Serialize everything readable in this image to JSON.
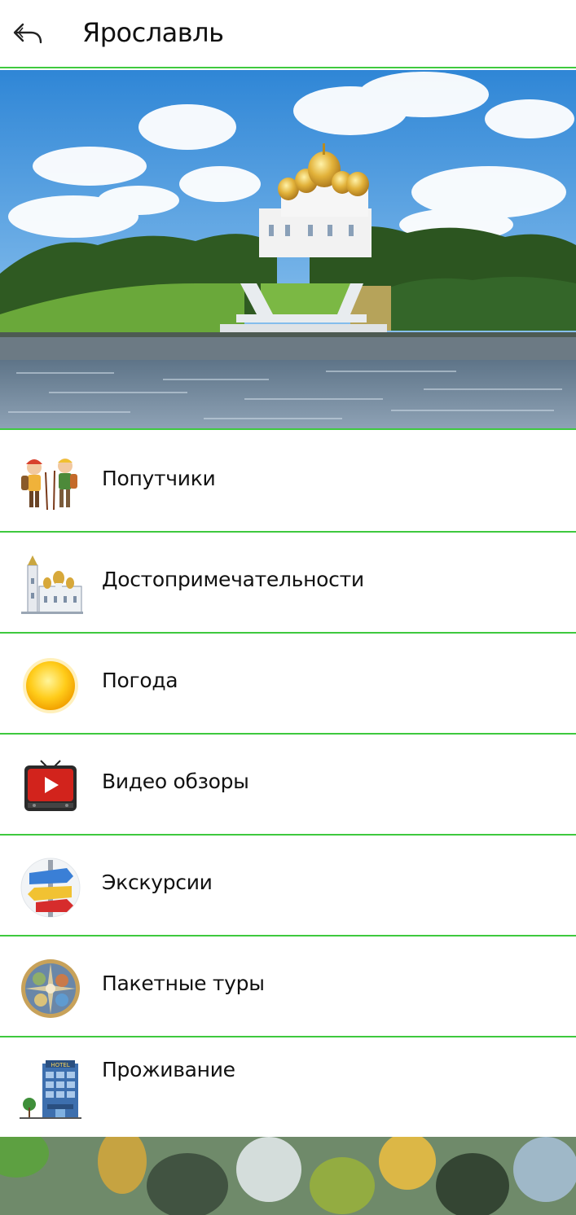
{
  "header": {
    "title": "Ярославль",
    "back_icon": "back-arrow-icon"
  },
  "hero": {
    "image": "yaroslavl-cathedral-photo"
  },
  "menu": {
    "items": [
      {
        "label": "Попутчики",
        "icon": "travelers-icon"
      },
      {
        "label": "Достопримечательности",
        "icon": "church-icon"
      },
      {
        "label": "Погода",
        "icon": "sun-icon"
      },
      {
        "label": "Видео обзоры",
        "icon": "tv-play-icon"
      },
      {
        "label": "Экскурсии",
        "icon": "signpost-icon"
      },
      {
        "label": "Пакетные туры",
        "icon": "tours-compass-icon"
      },
      {
        "label": "Проживание",
        "icon": "hotel-icon"
      }
    ]
  },
  "colors": {
    "accent": "#3ec93e"
  }
}
